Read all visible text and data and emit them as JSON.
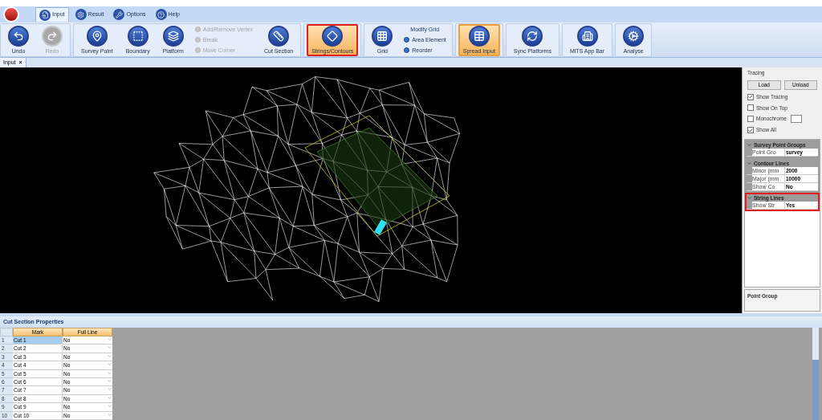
{
  "tabs": [
    {
      "label": "Input",
      "selected": true
    },
    {
      "label": "Result",
      "selected": false
    },
    {
      "label": "Options",
      "selected": false
    },
    {
      "label": "Help",
      "selected": false
    }
  ],
  "ribbon": {
    "groups": [
      {
        "items": [
          {
            "kind": "large",
            "label": "Undo",
            "disabled": false,
            "active": false,
            "highlighted": false
          },
          {
            "kind": "large",
            "label": "Redo",
            "disabled": true,
            "active": false,
            "highlighted": false
          }
        ]
      },
      {
        "items": [
          {
            "kind": "large",
            "label": "Survey Point",
            "disabled": false,
            "active": false,
            "highlighted": false
          },
          {
            "kind": "large",
            "label": "Boundary",
            "disabled": false,
            "active": false,
            "highlighted": false
          },
          {
            "kind": "large",
            "label": "Platform",
            "disabled": false,
            "active": false,
            "highlighted": false
          },
          {
            "kind": "stack",
            "items": [
              {
                "label": "Add/Remove Vertex",
                "disabled": true
              },
              {
                "label": "Break",
                "disabled": true
              },
              {
                "label": "Move Corner",
                "disabled": true
              }
            ]
          },
          {
            "kind": "large",
            "label": "Cut Section",
            "disabled": false,
            "active": false,
            "highlighted": false
          }
        ]
      },
      {
        "items": [
          {
            "kind": "large",
            "label": "Strings/Contours",
            "disabled": false,
            "active": true,
            "highlighted": true
          }
        ]
      },
      {
        "items": [
          {
            "kind": "large",
            "label": "Grid",
            "disabled": false,
            "active": false,
            "highlighted": false
          },
          {
            "kind": "stack",
            "title": "Modify Grid",
            "items": [
              {
                "label": "Area Element",
                "disabled": false
              },
              {
                "label": "Reorder",
                "disabled": false
              }
            ]
          }
        ]
      },
      {
        "items": [
          {
            "kind": "large",
            "label": "Spread Input",
            "disabled": false,
            "active": true,
            "highlighted": false
          }
        ]
      },
      {
        "items": [
          {
            "kind": "large",
            "label": "Sync Platforms",
            "disabled": false,
            "active": false,
            "highlighted": false
          }
        ]
      },
      {
        "items": [
          {
            "kind": "large",
            "label": "MiTS App Bar",
            "disabled": false,
            "active": false,
            "highlighted": false
          }
        ]
      },
      {
        "items": [
          {
            "kind": "large",
            "label": "Analyse",
            "disabled": false,
            "active": false,
            "highlighted": false
          }
        ]
      }
    ]
  },
  "document_tab": {
    "label": "Input",
    "close": "×"
  },
  "tracing": {
    "title": "Tracing",
    "buttons": [
      "Load",
      "Unload"
    ],
    "options": [
      {
        "label": "Show Tracing",
        "checked": true,
        "swatch": false
      },
      {
        "label": "Show On Top",
        "checked": false,
        "swatch": false
      },
      {
        "label": "Monochrome",
        "checked": false,
        "swatch": true
      },
      {
        "label": "Show All",
        "checked": true,
        "swatch": false
      }
    ]
  },
  "properties": {
    "categories": [
      {
        "name": "Survey Point Groups",
        "expanded": true,
        "highlighted": false,
        "rows": [
          {
            "name": "Point Gro",
            "value": "survey"
          }
        ]
      },
      {
        "name": "Contour Lines",
        "expanded": true,
        "highlighted": false,
        "rows": [
          {
            "name": "Minor (mm",
            "value": "2000"
          },
          {
            "name": "Major (mm",
            "value": "10000"
          },
          {
            "name": "Show Co",
            "value": "No"
          }
        ]
      },
      {
        "name": "String Lines",
        "expanded": true,
        "highlighted": true,
        "rows": [
          {
            "name": "Show Str",
            "value": "Yes"
          }
        ]
      }
    ],
    "description": "Point Group"
  },
  "cut_section": {
    "title": "Cut Section Properties",
    "columns": [
      "Mark",
      "Full Line"
    ],
    "rows": [
      {
        "index": "1",
        "mark": "Cut 1",
        "full_line": "No",
        "selected": true
      },
      {
        "index": "2",
        "mark": "Cut 2",
        "full_line": "No",
        "selected": false
      },
      {
        "index": "3",
        "mark": "Cut 3",
        "full_line": "No",
        "selected": false
      },
      {
        "index": "4",
        "mark": "Cut 4",
        "full_line": "No",
        "selected": false
      },
      {
        "index": "5",
        "mark": "Cut 5",
        "full_line": "No",
        "selected": false
      },
      {
        "index": "6",
        "mark": "Cut 6",
        "full_line": "No",
        "selected": false
      },
      {
        "index": "7",
        "mark": "Cut 7",
        "full_line": "No",
        "selected": false
      },
      {
        "index": "8",
        "mark": "Cut 8",
        "full_line": "No",
        "selected": false
      },
      {
        "index": "9",
        "mark": "Cut 9",
        "full_line": "No",
        "selected": false
      },
      {
        "index": "10",
        "mark": "Cut 10",
        "full_line": "No",
        "selected": false
      }
    ]
  }
}
